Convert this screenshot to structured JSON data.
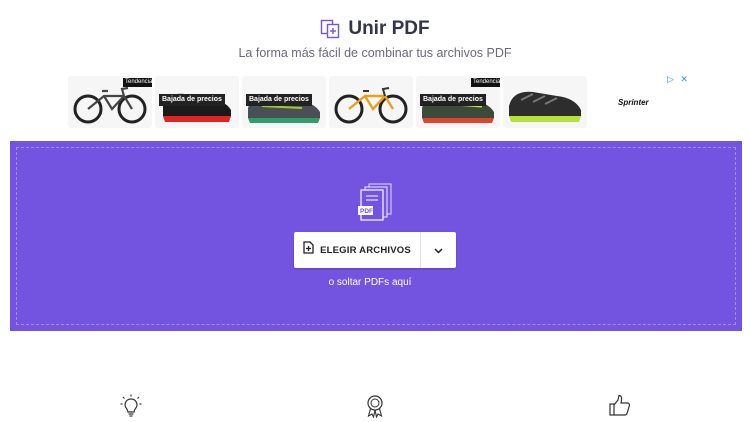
{
  "header": {
    "title": "Unir PDF",
    "subtitle": "La forma más fácil de combinar tus archivos PDF",
    "title_icon": "merge-files-icon"
  },
  "ad": {
    "brand": "Sprinter",
    "choices_label": "▷ ✕",
    "items": [
      {
        "badge": "Tendencia",
        "banner": "",
        "image": "mountain-bike-black"
      },
      {
        "badge": "",
        "banner": "Bajada de precios",
        "image": "cycling-shoe-red"
      },
      {
        "badge": "",
        "banner": "Bajada de precios",
        "image": "trail-shoe-grey"
      },
      {
        "badge": "",
        "banner": "",
        "image": "mountain-bike-orange"
      },
      {
        "badge": "Tendencia",
        "banner": "Bajada de precios",
        "image": "trail-shoe-yellow"
      },
      {
        "badge": "",
        "banner": "",
        "image": "trail-shoe-dark"
      }
    ]
  },
  "drop_zone": {
    "choose_label": "ELEGIR ARCHIVOS",
    "drop_hint": "o soltar PDFs aquí",
    "doc_icon": "pdf-files-icon",
    "accent": "#7354e0"
  },
  "features": [
    {
      "icon": "lightbulb-icon"
    },
    {
      "icon": "award-badge-icon"
    },
    {
      "icon": "thumbs-up-icon"
    }
  ]
}
